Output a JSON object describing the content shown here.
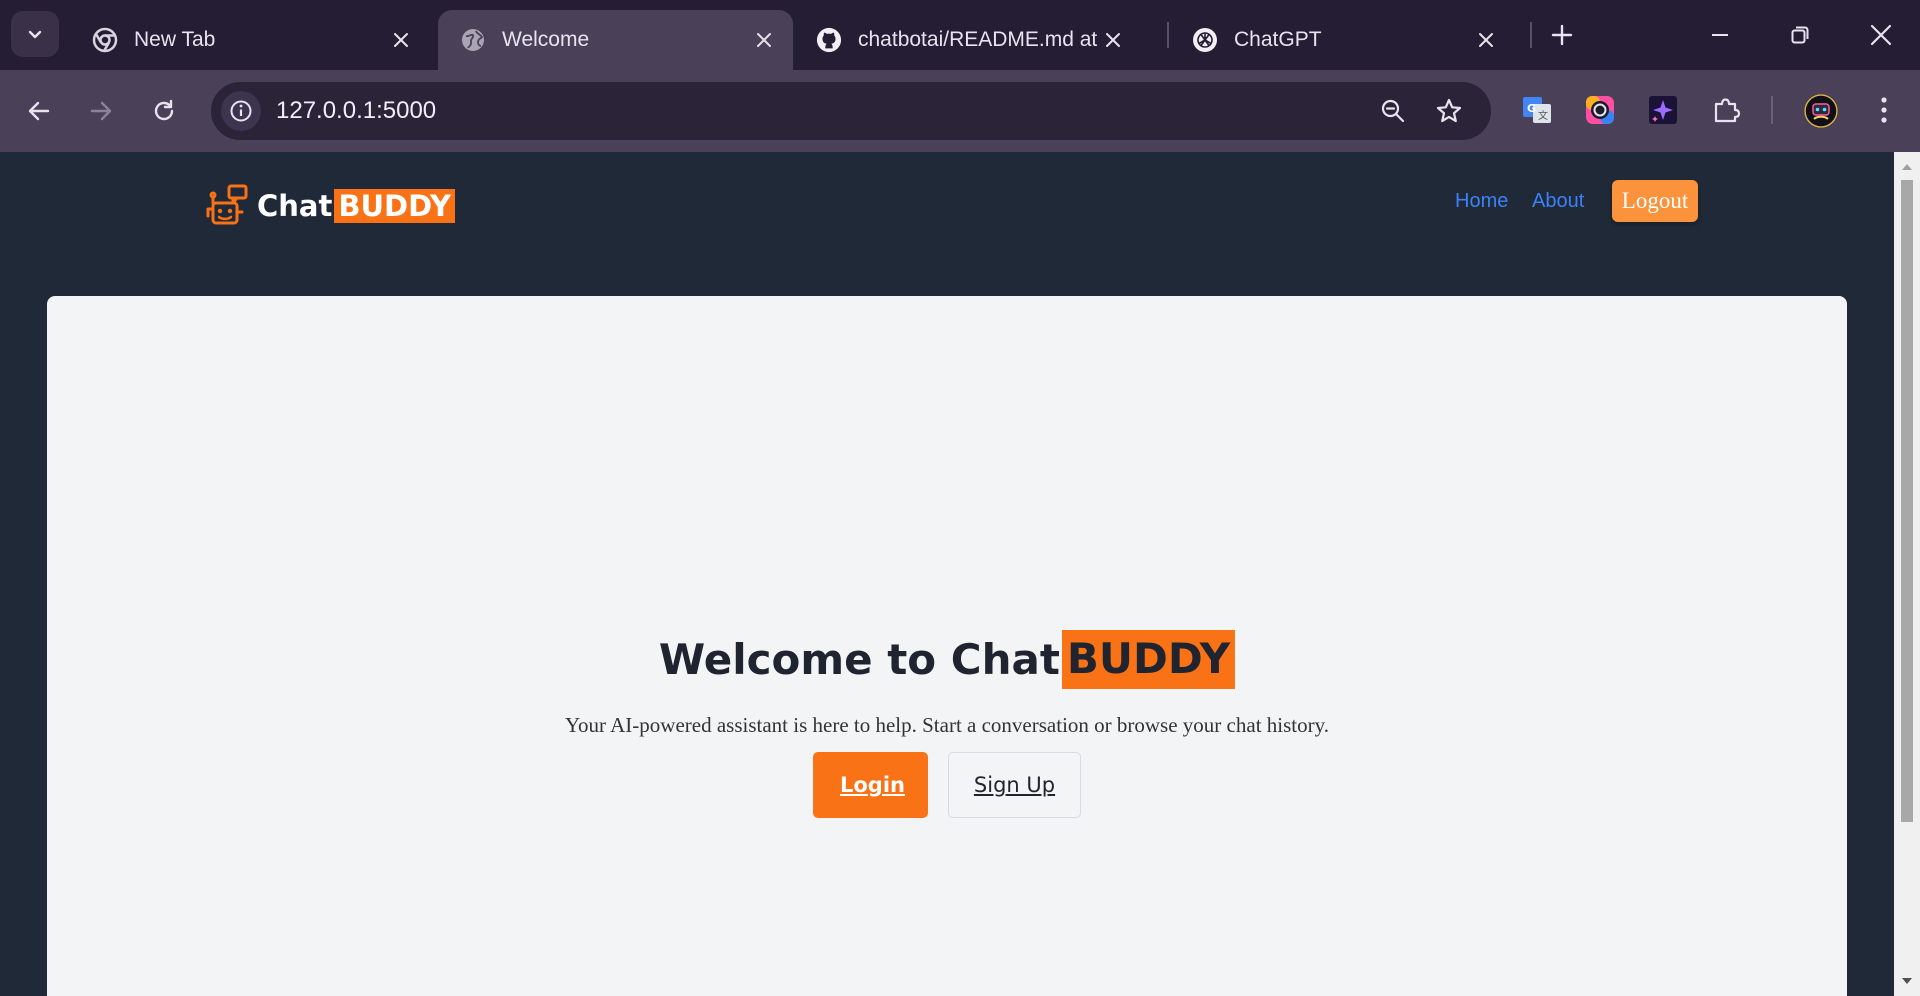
{
  "browser": {
    "tabs": [
      {
        "title": "New Tab",
        "icon": "chrome-icon",
        "active": false
      },
      {
        "title": "Welcome",
        "icon": "globe-icon",
        "active": true
      },
      {
        "title": "chatbotai/README.md at main",
        "icon": "github-icon",
        "active": false
      },
      {
        "title": "ChatGPT",
        "icon": "openai-icon",
        "active": false
      }
    ],
    "url": "127.0.0.1:5000"
  },
  "site": {
    "brand_prefix": "Chat",
    "brand_highlight": "BUDDY",
    "nav": {
      "home": "Home",
      "about": "About",
      "logout": "Logout"
    }
  },
  "hero": {
    "title_prefix": "Welcome to Chat",
    "title_highlight": "BUDDY",
    "subtitle": "Your AI-powered assistant is here to help. Start a conversation or browse your chat history.",
    "login_label": "Login ",
    "signup_label": "Sign Up"
  },
  "colors": {
    "accent": "#f97316",
    "page_bg": "#1f2937",
    "card_bg": "#f3f4f6",
    "nav_link": "#3b82f6",
    "logout_bg": "#fb923c"
  }
}
